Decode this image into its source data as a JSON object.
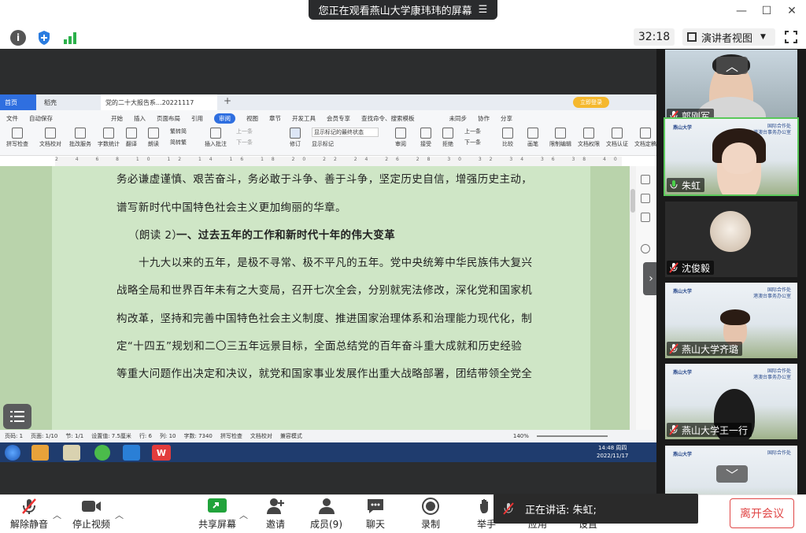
{
  "zoom": {
    "banner_text": "您正在观看燕山大学康玮玮的屏幕",
    "timer": "32:18",
    "view_mode": "演讲者视图",
    "speaking_label": "正在讲话:",
    "speaking_name": "朱虹;",
    "leave_label": "离开会议"
  },
  "toolbar": {
    "mute": "解除静音",
    "video": "停止视频",
    "share": "共享屏幕",
    "invite": "邀请",
    "members": "成员(9)",
    "chat": "聊天",
    "record": "录制",
    "raise": "举手",
    "apps": "应用",
    "settings": "设置"
  },
  "participants": [
    {
      "name": "郭刚军",
      "muted": true
    },
    {
      "name": "朱虹",
      "muted": false
    },
    {
      "name": "沈俊毅",
      "muted": true
    },
    {
      "name": "燕山大学齐璐",
      "muted": true
    },
    {
      "name": "燕山大学王一行",
      "muted": true
    }
  ],
  "tile_logo": {
    "left": "燕山大学",
    "right1": "国际合作处",
    "right2": "Office of International Cooperation",
    "right3": "港澳台事务办公室",
    "right4": "Office of Hong Kong, Macao and Taiwan Affairs"
  },
  "wps": {
    "tabs": [
      "首页",
      "稻壳",
      "党的二十大报告系...20221117"
    ],
    "menu": [
      "文件",
      "自动保存",
      "开始",
      "插入",
      "页面布局",
      "引用",
      "审阅",
      "视图",
      "章节",
      "开发工具",
      "会员专享",
      "查找命令、搜索模板",
      "未同步",
      "协作",
      "分享"
    ],
    "active_menu": "审阅",
    "ribbon": [
      "拼写检查",
      "文档校对",
      "批改服务",
      "字数统计",
      "翻译",
      "朗读",
      "繁转简",
      "简转繁",
      "插入批注",
      "上一条",
      "下一条",
      "修订",
      "显示标记的最终状态",
      "显示标记",
      "审阅",
      "接受",
      "拒绝",
      "上一条",
      "下一条",
      "比较",
      "画笔",
      "限制编辑",
      "文档权限",
      "文档认证",
      "文档定稿"
    ],
    "doc_lines": [
      "务必谦虚谨慎、艰苦奋斗，务必敢于斗争、善于斗争，坚定历史自信，增强历史主动，",
      "谱写新时代中国特色社会主义更加绚丽的华章。",
      "（朗读 2）",
      "一、过去五年的工作和新时代十年的伟大变革",
      "十九大以来的五年，是极不寻常、极不平凡的五年。党中央统筹中华民族伟大复兴",
      "战略全局和世界百年未有之大变局，召开七次全会，分别就宪法修改，深化党和国家机",
      "构改革，坚持和完善中国特色社会主义制度、推进国家治理体系和治理能力现代化，制",
      "定“十四五”规划和二〇三五年远景目标，全面总结党的百年奋斗重大成就和历史经验",
      "等重大问题作出决定和决议，就党和国家事业发展作出重大战略部署，团结带领全党全"
    ],
    "status": [
      "页码: 1",
      "页面: 1/10",
      "节: 1/1",
      "设置值: 7.5厘米",
      "行: 6",
      "列: 10",
      "字数: 7340",
      "拼写检查",
      "文档校对",
      "兼容模式"
    ],
    "zoom": "140%",
    "clock_time": "14:48 周四",
    "clock_date": "2022/11/17",
    "member_badge": "立即登录"
  },
  "colors": {
    "doc_green": "#cfe6c6",
    "active_outline": "#5ac85a",
    "leave_red": "#e04646",
    "taskbar": "#1f3c6e"
  }
}
